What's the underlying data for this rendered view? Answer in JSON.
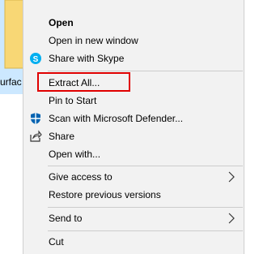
{
  "file": {
    "label": "urfac"
  },
  "menu": {
    "items": [
      {
        "label": "Open"
      },
      {
        "label": "Open in new window"
      },
      {
        "label": "Share with Skype"
      },
      {
        "label": "Extract All..."
      },
      {
        "label": "Pin to Start"
      },
      {
        "label": "Scan with Microsoft Defender..."
      },
      {
        "label": "Share"
      },
      {
        "label": "Open with..."
      },
      {
        "label": "Give access to"
      },
      {
        "label": "Restore previous versions"
      },
      {
        "label": "Send to"
      },
      {
        "label": "Cut"
      }
    ]
  },
  "colors": {
    "menu_background": "#f2f2f2",
    "highlight_border": "#e00000",
    "selection": "#cce8ff",
    "skype": "#00aff0",
    "defender": "#0063b1"
  }
}
